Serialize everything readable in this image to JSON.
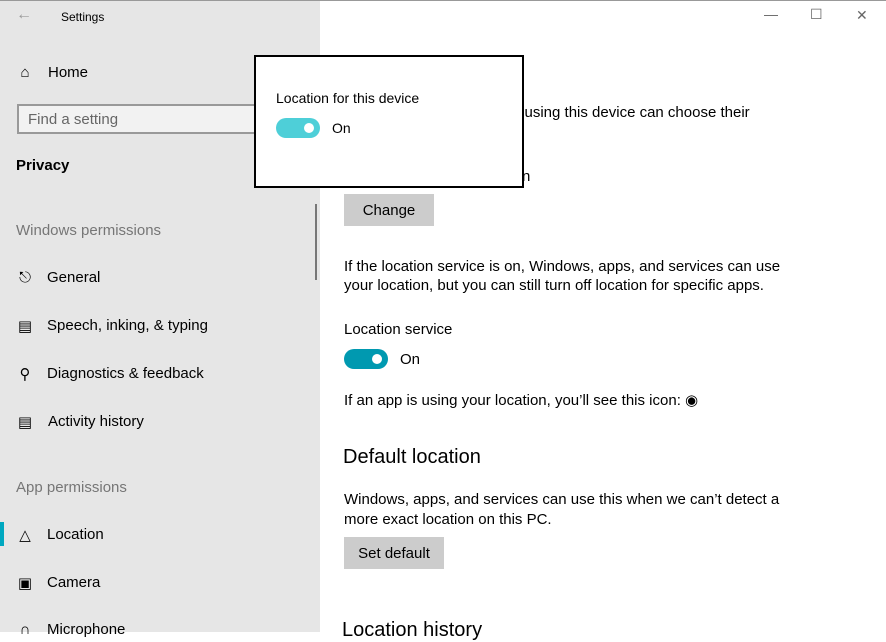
{
  "window": {
    "title": "Settings",
    "minimize": "—",
    "maximize": "☐",
    "close": "✕"
  },
  "sidebar": {
    "home": "Home",
    "search_placeholder": "Find a setting",
    "category": "Privacy",
    "windows_permissions": "Windows permissions",
    "items": [
      {
        "label": "General",
        "icon": "lock-icon"
      },
      {
        "label": "Speech, inking, & typing",
        "icon": "clipboard-icon"
      },
      {
        "label": "Diagnostics & feedback",
        "icon": "feedback-icon"
      },
      {
        "label": "Activity history",
        "icon": "timeline-icon"
      }
    ],
    "app_permissions": "App permissions",
    "app_items": [
      {
        "label": "Location",
        "icon": "location-icon",
        "selected": true
      },
      {
        "label": "Camera",
        "icon": "camera-icon"
      },
      {
        "label": "Microphone",
        "icon": "microphone-icon"
      }
    ]
  },
  "main": {
    "partial_line1": "n using this device can choose their",
    "partial_line2": "n",
    "change_button": "Change",
    "service_desc_1": "If the location service is on, Windows, apps, and services can use",
    "service_desc_2": "your location, but you can still turn off location for specific apps.",
    "service_label": "Location service",
    "service_state": "On",
    "icon_note": "If an app is using your location, you’ll see this icon:",
    "default_heading": "Default location",
    "default_desc_1": "Windows, apps, and services can use this when we can’t detect a",
    "default_desc_2": "more exact location on this PC.",
    "set_default_button": "Set default",
    "history_heading": "Location history"
  },
  "popup": {
    "label": "Location for this device",
    "state": "On"
  },
  "colors": {
    "accent": "#00a8c0",
    "toggle_on": "#0099b0",
    "popup_toggle": "#4ecfd8",
    "sidebar_bg": "#e6e6e6"
  }
}
